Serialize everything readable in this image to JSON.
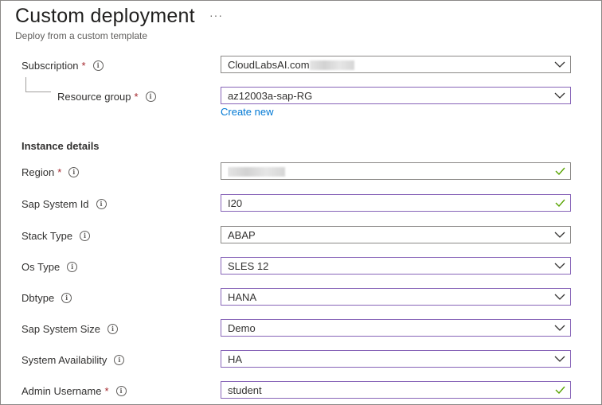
{
  "header": {
    "title": "Custom deployment",
    "more_icon": "ellipsis-icon",
    "subtitle": "Deploy from a custom template"
  },
  "colors": {
    "required": "#a4262c",
    "link": "#0078d4",
    "valid_check": "#57a300",
    "field_focus_border": "#8764b8"
  },
  "project": {
    "subscription_label": "Subscription",
    "subscription_value": "CloudLabsAI.com",
    "resource_group_label": "Resource group",
    "resource_group_value": "az12003a-sap-RG",
    "create_new_label": "Create new"
  },
  "instance": {
    "section_title": "Instance details",
    "required_mark": "*",
    "fields": [
      {
        "label": "Region",
        "value": "",
        "required": true,
        "control": "text-valid"
      },
      {
        "label": "Sap System Id",
        "value": "I20",
        "required": false,
        "control": "text-valid"
      },
      {
        "label": "Stack Type",
        "value": "ABAP",
        "required": false,
        "control": "dropdown"
      },
      {
        "label": "Os Type",
        "value": "SLES 12",
        "required": false,
        "control": "dropdown"
      },
      {
        "label": "Dbtype",
        "value": "HANA",
        "required": false,
        "control": "dropdown"
      },
      {
        "label": "Sap System Size",
        "value": "Demo",
        "required": false,
        "control": "dropdown"
      },
      {
        "label": "System Availability",
        "value": "HA",
        "required": false,
        "control": "dropdown"
      },
      {
        "label": "Admin Username",
        "value": "student",
        "required": true,
        "control": "text-valid"
      }
    ]
  }
}
